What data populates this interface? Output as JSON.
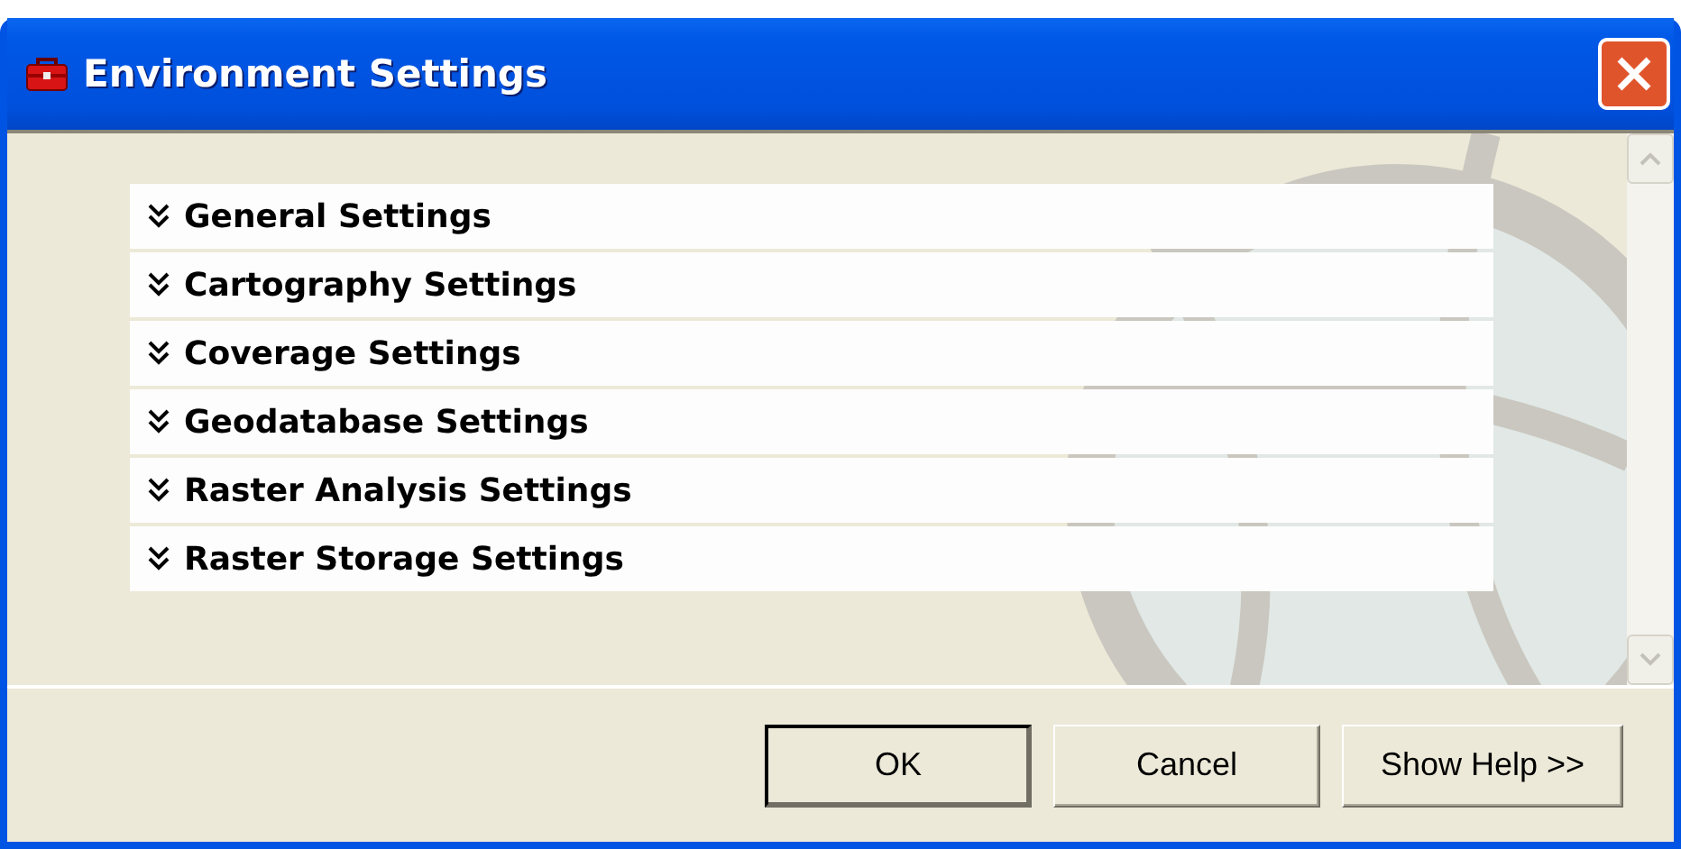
{
  "window": {
    "title": "Environment Settings"
  },
  "sections": [
    {
      "label": "General Settings",
      "expanded": false
    },
    {
      "label": "Cartography Settings",
      "expanded": false
    },
    {
      "label": "Coverage Settings",
      "expanded": false
    },
    {
      "label": "Geodatabase Settings",
      "expanded": false
    },
    {
      "label": "Raster Analysis Settings",
      "expanded": false
    },
    {
      "label": "Raster Storage Settings",
      "expanded": false
    }
  ],
  "buttons": [
    {
      "label": "OK",
      "default": true
    },
    {
      "label": "Cancel",
      "default": false
    },
    {
      "label": "Show Help >>",
      "default": false
    }
  ]
}
